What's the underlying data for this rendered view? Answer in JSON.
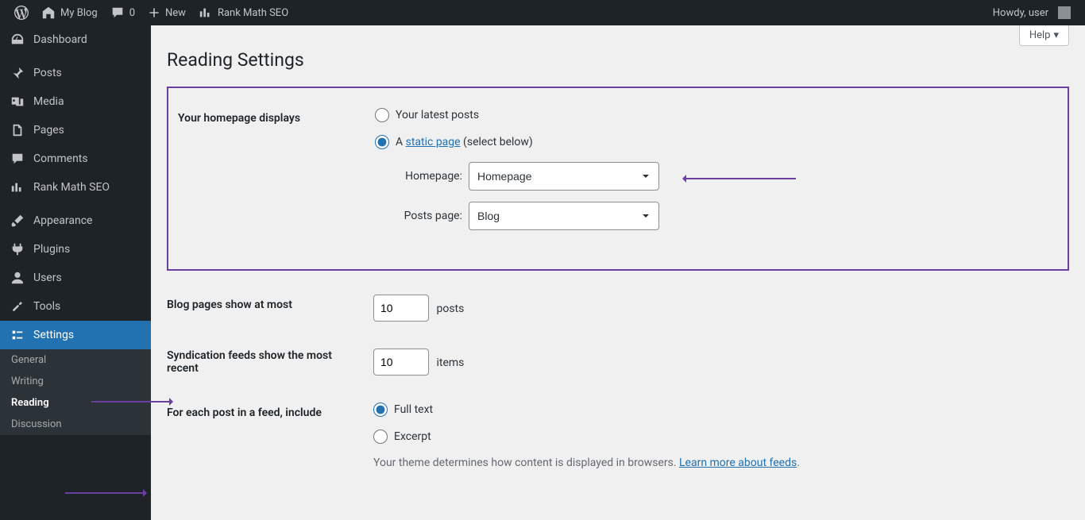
{
  "adminbar": {
    "site_name": "My Blog",
    "comments_count": "0",
    "new_label": "New",
    "rankmath_label": "Rank Math SEO",
    "howdy": "Howdy, user"
  },
  "sidebar": {
    "dashboard": "Dashboard",
    "posts": "Posts",
    "media": "Media",
    "pages": "Pages",
    "comments": "Comments",
    "rankmath": "Rank Math SEO",
    "appearance": "Appearance",
    "plugins": "Plugins",
    "users": "Users",
    "tools": "Tools",
    "settings": "Settings",
    "submenu": {
      "general": "General",
      "writing": "Writing",
      "reading": "Reading",
      "discussion": "Discussion"
    }
  },
  "content": {
    "help": "Help",
    "title": "Reading Settings",
    "homepage_displays_label": "Your homepage displays",
    "opt_latest_posts": "Your latest posts",
    "opt_static_prefix": "A ",
    "opt_static_link": "static page",
    "opt_static_suffix": " (select below)",
    "homepage_label": "Homepage:",
    "homepage_value": "Homepage",
    "posts_page_label": "Posts page:",
    "posts_page_value": "Blog",
    "blog_pages_label": "Blog pages show at most",
    "blog_pages_value": "10",
    "blog_pages_unit": "posts",
    "syndication_label": "Syndication feeds show the most recent",
    "syndication_value": "10",
    "syndication_unit": "items",
    "feed_include_label": "For each post in a feed, include",
    "feed_full_text": "Full text",
    "feed_excerpt": "Excerpt",
    "feed_desc_prefix": "Your theme determines how content is displayed in browsers. ",
    "feed_desc_link": "Learn more about feeds",
    "feed_desc_suffix": "."
  }
}
